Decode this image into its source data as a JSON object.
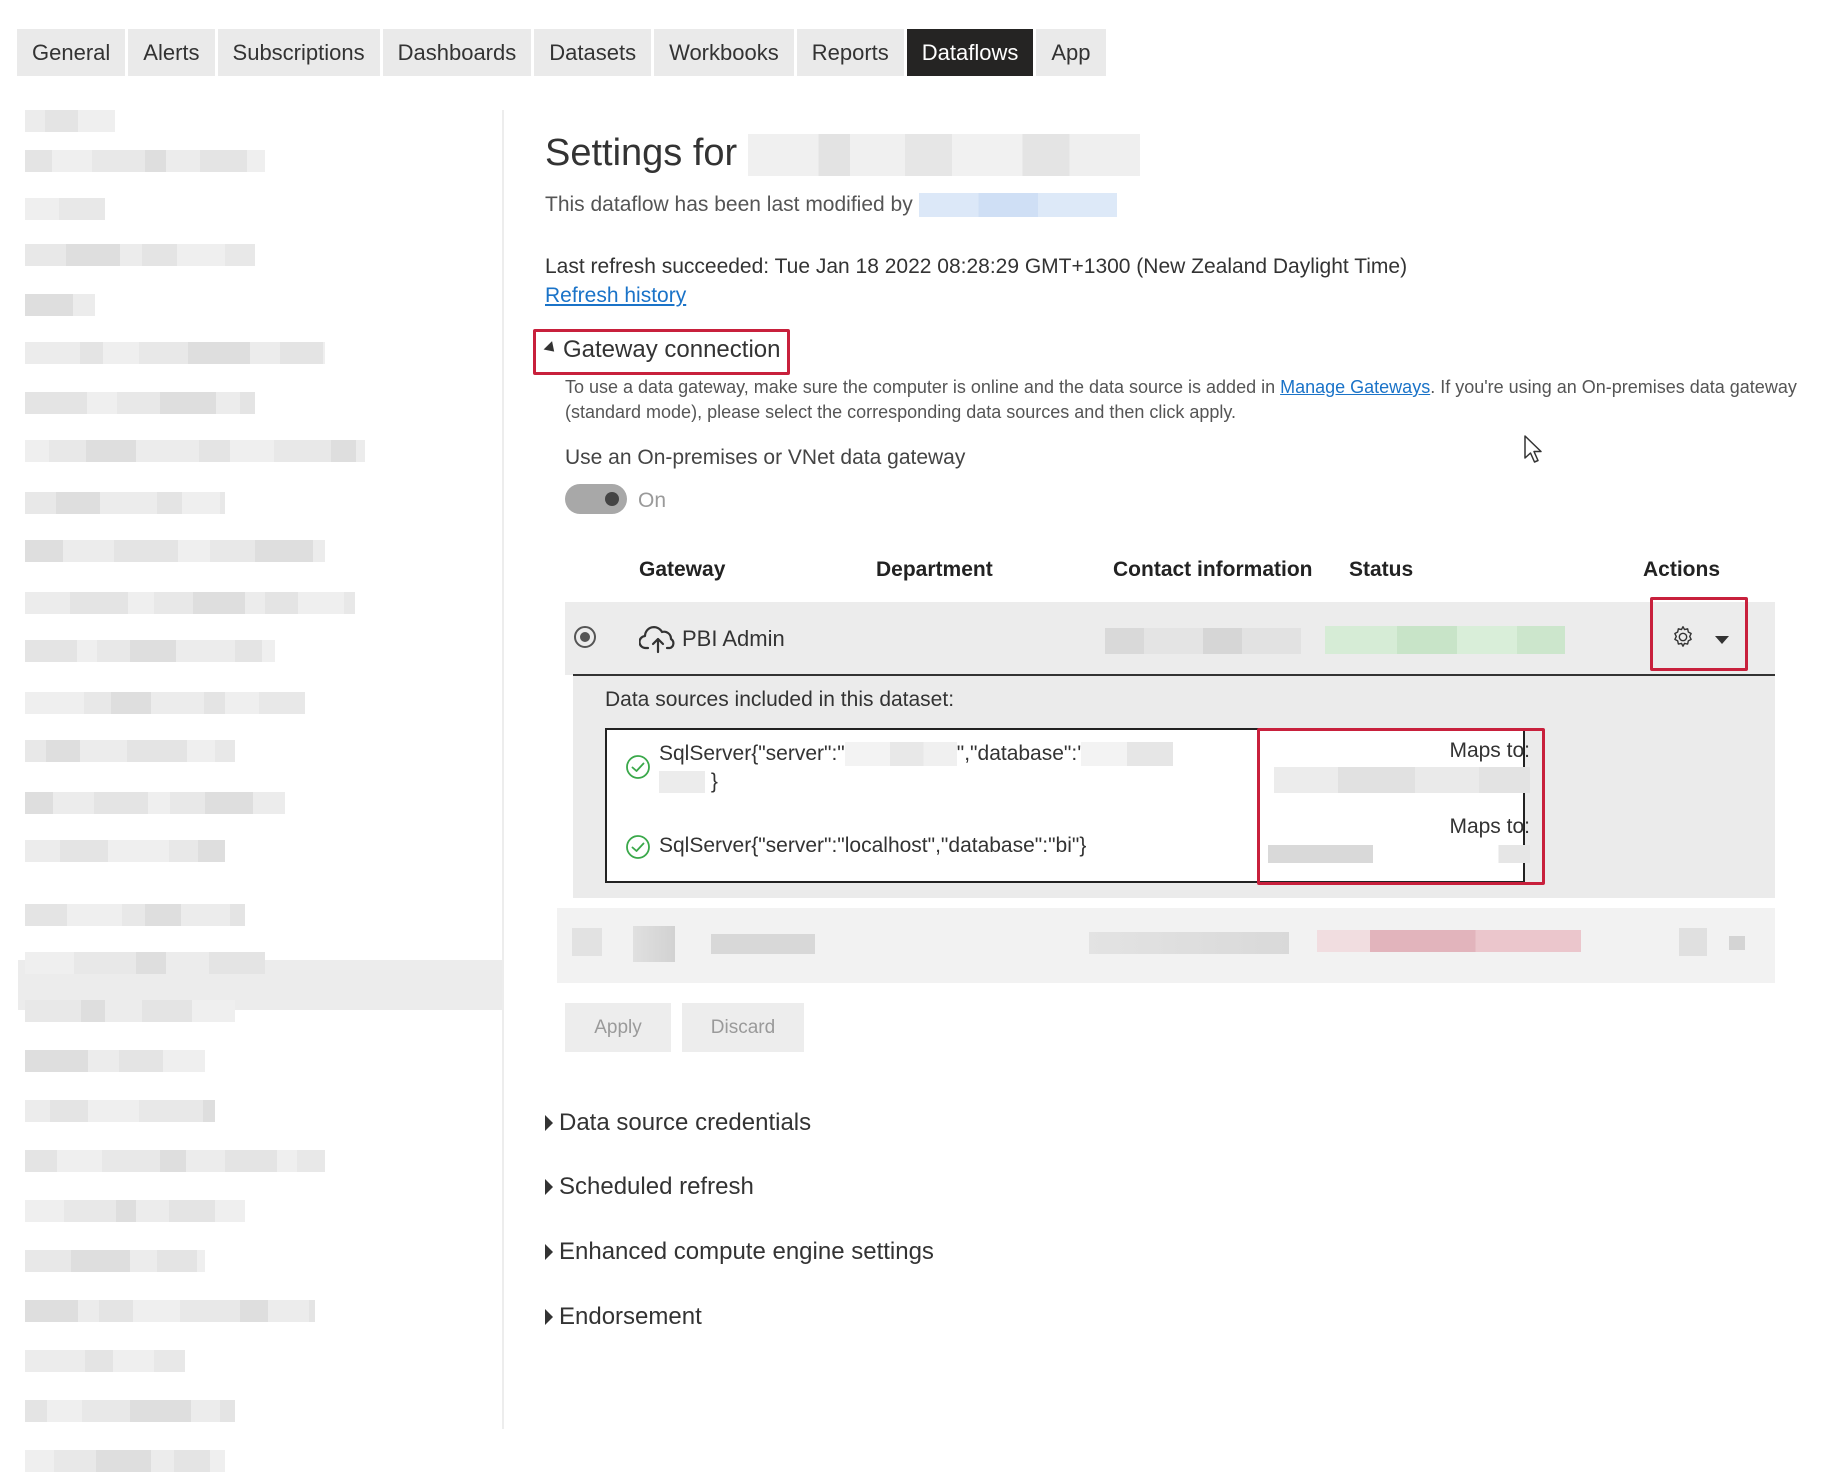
{
  "tabs": [
    {
      "label": "General",
      "active": false
    },
    {
      "label": "Alerts",
      "active": false
    },
    {
      "label": "Subscriptions",
      "active": false
    },
    {
      "label": "Dashboards",
      "active": false
    },
    {
      "label": "Datasets",
      "active": false
    },
    {
      "label": "Workbooks",
      "active": false
    },
    {
      "label": "Reports",
      "active": false
    },
    {
      "label": "Dataflows",
      "active": true
    },
    {
      "label": "App",
      "active": false
    }
  ],
  "settings": {
    "title_prefix": "Settings for",
    "modified_prefix": "This dataflow has been last modified by",
    "last_refresh": "Last refresh succeeded: Tue Jan 18 2022 08:28:29 GMT+1300 (New Zealand Daylight Time)",
    "refresh_history_link": "Refresh history"
  },
  "gateway": {
    "header": "Gateway connection",
    "desc_before": "To use a data gateway, make sure the computer is online and the data source is added in ",
    "desc_link": "Manage Gateways",
    "desc_after": ". If you're using an On-premises data gateway (standard mode), please select the corresponding data sources and then click apply.",
    "toggle_label": "Use an On-premises or VNet data gateway",
    "toggle_state": "On",
    "columns": {
      "gateway": "Gateway",
      "department": "Department",
      "contact": "Contact information",
      "status": "Status",
      "actions": "Actions"
    },
    "row": {
      "name": "PBI Admin"
    },
    "datasources": {
      "title": "Data sources included in this dataset:",
      "item1_a": "SqlServer{\"server\":\"",
      "item1_b": "\",\"database\":'",
      "item1_c": "}",
      "item2": "SqlServer{\"server\":\"localhost\",\"database\":\"bi\"}",
      "maps_to": "Maps to:"
    },
    "buttons": {
      "apply": "Apply",
      "discard": "Discard"
    }
  },
  "sections": {
    "credentials": "Data source credentials",
    "scheduled": "Scheduled refresh",
    "enhanced": "Enhanced compute engine settings",
    "endorsement": "Endorsement"
  },
  "colors": {
    "accent_link": "#1a73c8",
    "highlight_box": "#c8203c",
    "active_tab": "#252423",
    "status_ok_blur": "#cfe8cf",
    "status_err_blur": "#e8c3c8",
    "check_green": "#3aa84a"
  }
}
